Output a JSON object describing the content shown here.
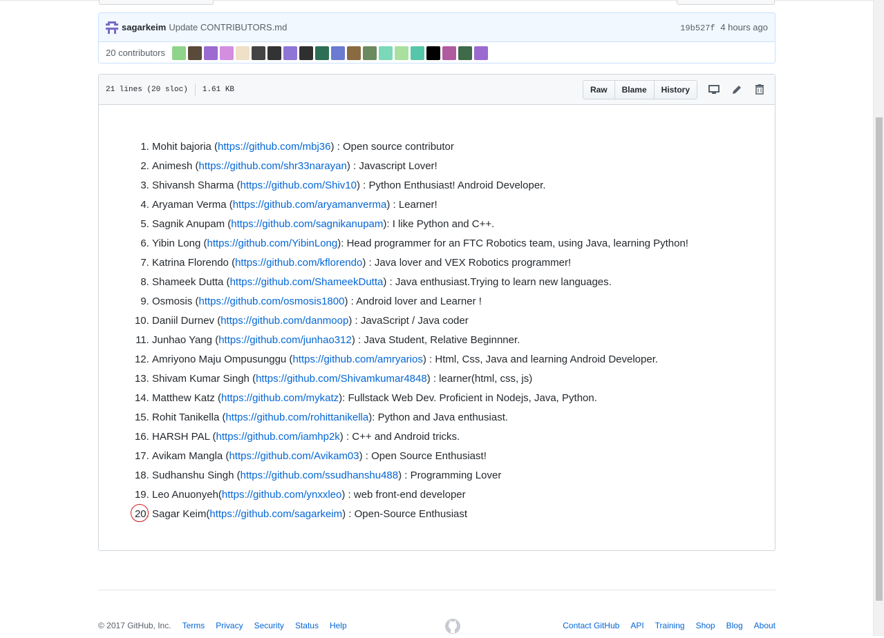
{
  "commit": {
    "author": "sagarkeim",
    "message": "Update CONTRIBUTORS.md",
    "sha": "19b527f",
    "time": "4 hours ago"
  },
  "contributors_bar": {
    "count_label": "20 contributors",
    "avatar_colors": [
      "#8fd48b",
      "#5a4a3a",
      "#9b6bd1",
      "#d38ee0",
      "#efe0c8",
      "#444444",
      "#333333",
      "#8e75d6",
      "#2f2f2f",
      "#2c6f55",
      "#6a7bd1",
      "#8a6a40",
      "#6b8a60",
      "#7bd8b8",
      "#a9e0a0",
      "#55c7a8",
      "#000000",
      "#b05aa0",
      "#3e6a4a",
      "#9a6ad0"
    ]
  },
  "file": {
    "lines": "21 lines (20 sloc)",
    "size": "1.61 KB",
    "buttons": {
      "raw": "Raw",
      "blame": "Blame",
      "history": "History"
    }
  },
  "entries": [
    {
      "name": "Mohit bajoria (",
      "url": "https://github.com/mbj36",
      "desc": ") : Open source contributor"
    },
    {
      "name": "Animesh (",
      "url": "https://github.com/shr33narayan",
      "desc": ") : Javascript Lover!"
    },
    {
      "name": "Shivansh Sharma (",
      "url": "https://github.com/Shiv10",
      "desc": ") : Python Enthusiast! Android Developer."
    },
    {
      "name": "Aryaman Verma (",
      "url": "https://github.com/aryamanverma",
      "desc": ") : Learner!"
    },
    {
      "name": "Sagnik Anupam (",
      "url": "https://github.com/sagnikanupam",
      "desc": "): I like Python and C++."
    },
    {
      "name": "Yibin Long (",
      "url": "https://github.com/YibinLong",
      "desc": "): Head programmer for an FTC Robotics team, using Java, learning Python!"
    },
    {
      "name": "Katrina Florendo (",
      "url": "https://github.com/kflorendo",
      "desc": ") : Java lover and VEX Robotics programmer!"
    },
    {
      "name": "Shameek Dutta (",
      "url": "https://github.com/ShameekDutta",
      "desc": ") : Java enthusiast.Trying to learn new languages."
    },
    {
      "name": "Osmosis (",
      "url": "https://github.com/osmosis1800",
      "desc": ") : Android lover and Learner !"
    },
    {
      "name": "Daniil Durnev (",
      "url": "https://github.com/danmoop",
      "desc": ") : JavaScript / Java coder"
    },
    {
      "name": "Junhao Yang (",
      "url": "https://github.com/junhao312",
      "desc": ") : Java Student, Relative Beginnner."
    },
    {
      "name": "Amriyono Maju Ompusunggu (",
      "url": "https://github.com/amryarios",
      "desc": ") : Html, Css, Java and learning Android Developer."
    },
    {
      "name": "Shivam Kumar Singh (",
      "url": "https://github.com/Shivamkumar4848",
      "desc": ") : learner(html, css, js)"
    },
    {
      "name": "Matthew Katz (",
      "url": "https://github.com/mykatz",
      "desc": "): Fullstack Web Dev. Proficient in Nodejs, Java, Python."
    },
    {
      "name": "Rohit Tanikella (",
      "url": "https://github.com/rohittanikella",
      "desc": "): Python and Java enthusiast."
    },
    {
      "name": "HARSH PAL (",
      "url": "https://github.com/iamhp2k",
      "desc": ") : C++ and Android tricks."
    },
    {
      "name": "Avikam Mangla (",
      "url": "https://github.com/Avikam03",
      "desc": ") : Open Source Enthusiast!"
    },
    {
      "name": "Sudhanshu Singh (",
      "url": "https://github.com/ssudhanshu488",
      "desc": ") : Programming Lover"
    },
    {
      "name": "Leo Anuonyeh(",
      "url": "https://github.com/ynxxleo",
      "desc": ") : web front-end developer"
    },
    {
      "name": "Sagar Keim(",
      "url": "https://github.com/sagarkeim",
      "desc": ") : Open-Source Enthusiast"
    }
  ],
  "footer": {
    "copyright": "© 2017 GitHub, Inc.",
    "left_links": [
      "Terms",
      "Privacy",
      "Security",
      "Status",
      "Help"
    ],
    "right_links": [
      "Contact GitHub",
      "API",
      "Training",
      "Shop",
      "Blog",
      "About"
    ]
  }
}
